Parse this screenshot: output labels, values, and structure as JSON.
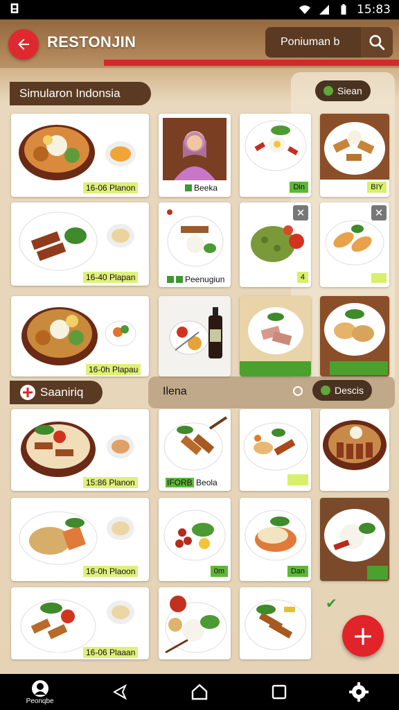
{
  "status": {
    "time": "15:83"
  },
  "header": {
    "title": "RESTONJIN",
    "search_text": "Poniuman b",
    "colors": {
      "accent": "#e0292e",
      "brown": "#5a3a22"
    }
  },
  "section1": {
    "title": "Simularon Indonsia",
    "chip": "Siean",
    "cards": [
      {
        "label": "16-06 Planon"
      },
      {
        "label": "Beeka"
      },
      {
        "label": "Din"
      },
      {
        "label": "BIY"
      },
      {
        "label": "16-40 Plapan"
      },
      {
        "label": "Peenugiun"
      },
      {
        "label": "4"
      },
      {
        "label": ""
      },
      {
        "label": "16-0h Plapau"
      },
      {
        "label": ""
      },
      {
        "label": ""
      },
      {
        "label": ""
      }
    ]
  },
  "section2": {
    "title": "Saaniriq",
    "menu_title": "Ilena",
    "chip": "Descis",
    "cards": [
      {
        "label": "15:86 Planon"
      },
      {
        "label": "Beola",
        "prefix": "IFORB"
      },
      {
        "label": ""
      },
      {
        "label": ""
      },
      {
        "label": ""
      },
      {
        "label": ""
      },
      {
        "label": "0m"
      },
      {
        "label": "Dan"
      },
      {
        "label": "16-0h Plaoon"
      },
      {
        "label": "16-06 Plaaan"
      }
    ]
  },
  "nav": {
    "profile_label": "Peonqbe"
  },
  "fab": {
    "symbol": "+"
  }
}
